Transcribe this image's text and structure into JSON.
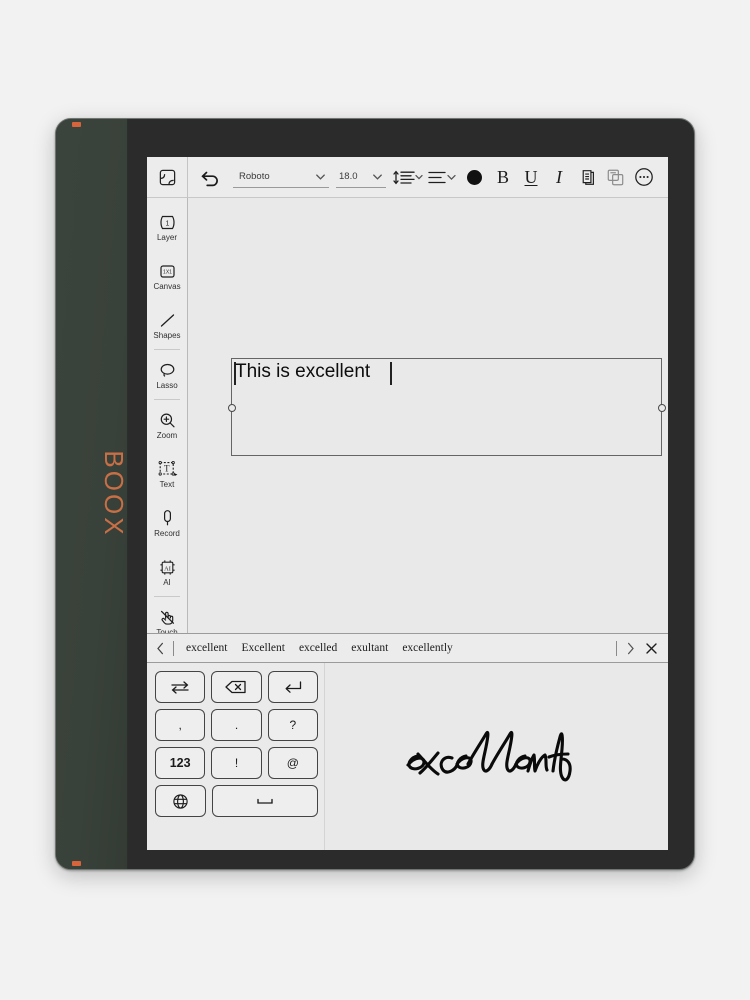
{
  "device": {
    "brand_logo": "BOOX",
    "accent_color": "#c96f46",
    "body_color": "#2b2b2b",
    "panel_color": "#3b443c"
  },
  "toolbar": {
    "panel_toggle_icon": "collapse-panel-icon",
    "undo_icon": "undo-icon",
    "font_family": "Roboto",
    "font_size": "18.0",
    "line_spacing_icon": "line-spacing-icon",
    "align_icon": "text-align-icon",
    "color_swatch": "#111111",
    "color_label": "",
    "bold_label": "B",
    "underline_label": "U",
    "italic_label": "I",
    "duplicate_icon": "duplicate-icon",
    "arrange_icon": "arrange-layers-icon",
    "more_icon": "more-options-icon"
  },
  "tool_rail": {
    "items": [
      {
        "label": "Layer",
        "icon": "layer-icon",
        "active": false
      },
      {
        "label": "Canvas",
        "icon": "canvas-icon",
        "active": false
      },
      {
        "label": "Shapes",
        "icon": "shapes-icon",
        "active": false
      },
      {
        "label": "Lasso",
        "icon": "lasso-icon",
        "active": false
      },
      {
        "label": "Zoom",
        "icon": "zoom-icon",
        "active": false
      },
      {
        "label": "Text",
        "icon": "text-tool-icon",
        "active": true
      },
      {
        "label": "Record",
        "icon": "microphone-icon",
        "active": false
      },
      {
        "label": "AI",
        "icon": "ai-chip-icon",
        "active": false
      },
      {
        "label": "Touch",
        "icon": "touch-disable-icon",
        "active": false
      }
    ]
  },
  "canvas": {
    "textbox_value": "This is excellent",
    "textbox_placeholder": "",
    "handwriting_ink": "excellent"
  },
  "suggestions": {
    "prev_icon": "chevron-left-icon",
    "next_icon": "chevron-right-icon",
    "close_icon": "close-icon",
    "words": [
      "excellent",
      "Excellent",
      "excelled",
      "exultant",
      "excellently"
    ]
  },
  "keyboard": {
    "rows": [
      [
        {
          "label": "",
          "icon": "switch-layout-icon",
          "wide": false
        },
        {
          "label": "",
          "icon": "backspace-icon",
          "wide": false
        },
        {
          "label": "",
          "icon": "enter-icon",
          "wide": false
        }
      ],
      [
        {
          "label": ",",
          "icon": "",
          "wide": false
        },
        {
          "label": ".",
          "icon": "",
          "wide": false
        },
        {
          "label": "?",
          "icon": "",
          "wide": false
        }
      ],
      [
        {
          "label": "123",
          "icon": "",
          "wide": false
        },
        {
          "label": "!",
          "icon": "",
          "wide": false
        },
        {
          "label": "@",
          "icon": "",
          "wide": false
        }
      ],
      [
        {
          "label": "",
          "icon": "globe-icon",
          "wide": false
        },
        {
          "label": "",
          "icon": "space-icon",
          "wide": true
        }
      ]
    ]
  }
}
